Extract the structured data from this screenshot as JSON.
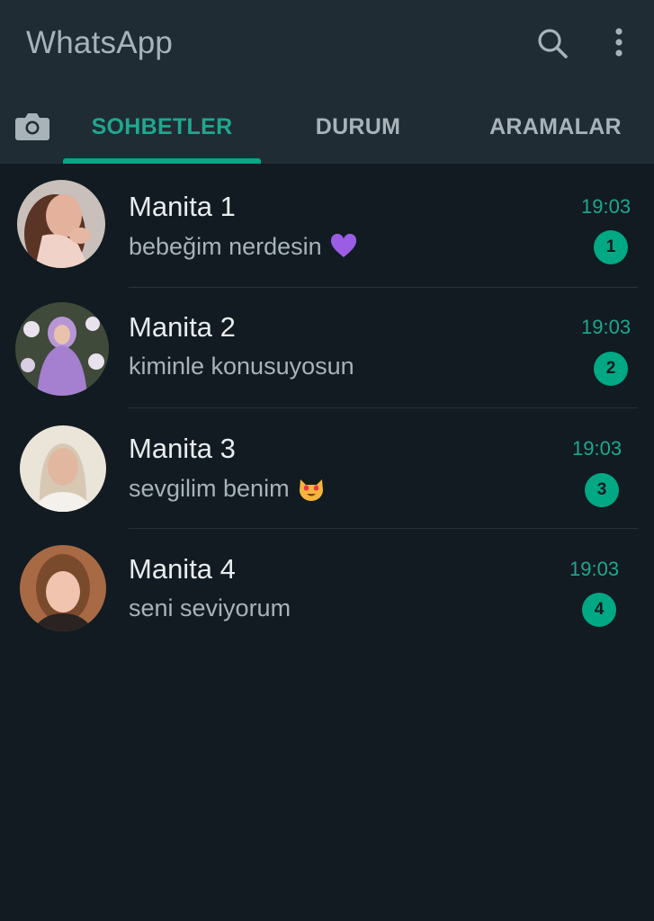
{
  "header": {
    "title": "WhatsApp",
    "icons": [
      "search-icon",
      "more-vert-icon"
    ]
  },
  "tabs": [
    {
      "label": "SOHBETLER",
      "active": true
    },
    {
      "label": "DURUM",
      "active": false
    },
    {
      "label": "ARAMALAR",
      "active": false
    }
  ],
  "camera_icon": "camera-icon",
  "chats": [
    {
      "name": "Manita 1",
      "message": "bebeğim nerdesin",
      "emoji": "purple-heart-emoji",
      "time": "19:03",
      "unread": "1"
    },
    {
      "name": "Manita 2",
      "message": "kiminle konusuyosun",
      "emoji": "",
      "time": "19:03",
      "unread": "2"
    },
    {
      "name": "Manita 3",
      "message": "sevgilim benim",
      "emoji": "heart-eyes-cat-emoji",
      "time": "19:03",
      "unread": "3"
    },
    {
      "name": "Manita 4",
      "message": "seni seviyorum",
      "emoji": "",
      "time": "19:03",
      "unread": "4"
    }
  ],
  "colors": {
    "background": "#111b21",
    "header": "#1f2c34",
    "accent": "#00a884",
    "accent_text": "#1fa78f",
    "secondary_text": "#a8b3b9"
  }
}
